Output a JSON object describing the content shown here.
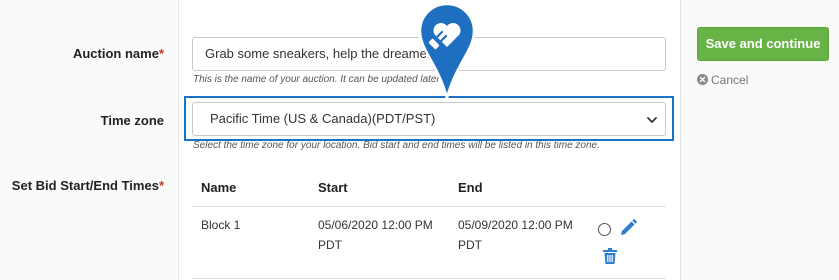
{
  "form": {
    "auction_name": {
      "label": "Auction name",
      "required_mark": "*",
      "value": "Grab some sneakers, help the dreamers",
      "help": "This is the name of your auction. It can be updated later."
    },
    "time_zone": {
      "label": "Time zone",
      "selected": "Pacific Time (US & Canada)(PDT/PST)",
      "help": "Select the time zone for your location. Bid start and end times will be listed in this time zone."
    },
    "bid_times": {
      "label": "Set Bid Start/End Times",
      "required_mark": "*",
      "columns": [
        "Name",
        "Start",
        "End"
      ],
      "rows": [
        {
          "name": "Block 1",
          "start_line1": "05/06/2020 12:00 PM",
          "start_line2": "PDT",
          "end_line1": "05/09/2020 12:00 PM",
          "end_line2": "PDT"
        }
      ]
    }
  },
  "actions": {
    "save_label": "Save and continue",
    "cancel_label": "Cancel"
  },
  "icons": {
    "pin": "heart-hand-marker-icon",
    "radio": "radio-button-icon",
    "edit": "pencil-icon",
    "delete": "trash-icon",
    "cancel": "close-circle-icon",
    "select": "chevron-down-icon"
  },
  "colors": {
    "save_button": "#67b346",
    "highlight": "#1a73c5",
    "required": "#c0392b",
    "edit_icon": "#2f7fd0"
  }
}
